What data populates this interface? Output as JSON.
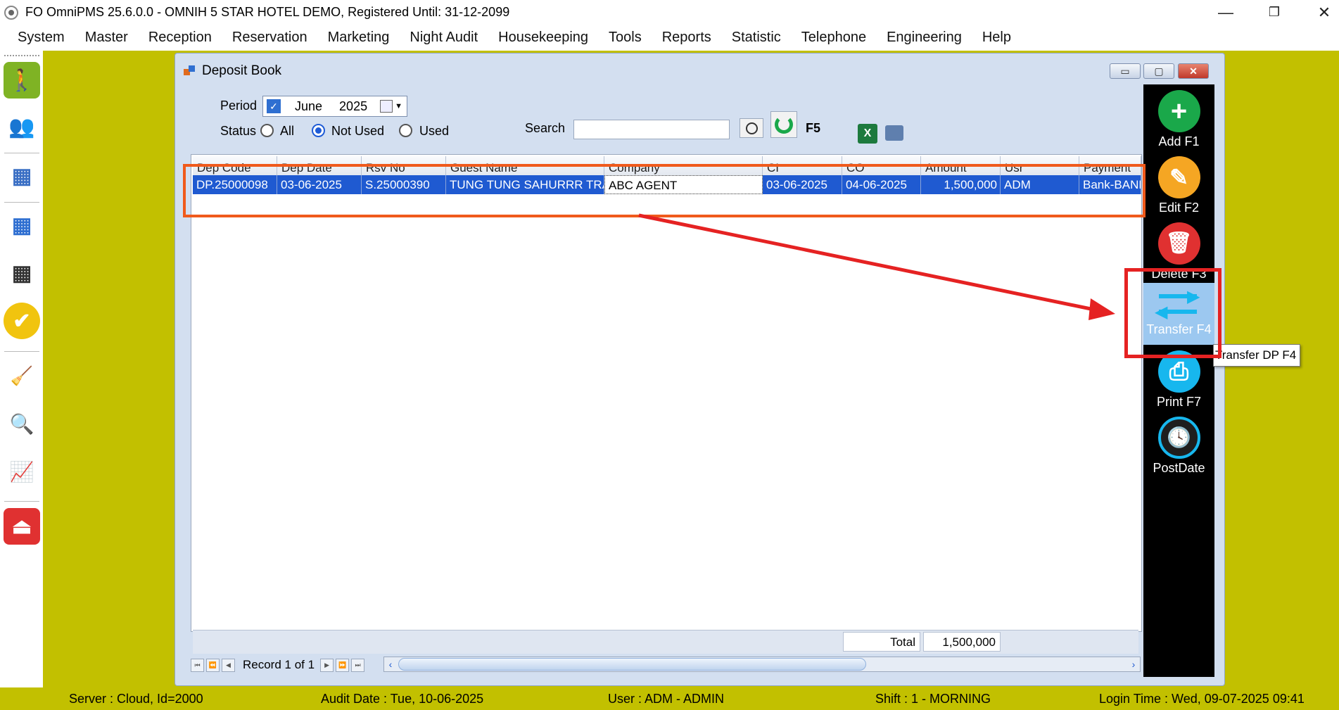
{
  "app": {
    "title": "FO OmniPMS 25.6.0.0 - OMNIH 5 STAR HOTEL DEMO, Registered Until: 31-12-2099",
    "controls": {
      "minimize": "—",
      "restore": "❐",
      "close": "✕"
    }
  },
  "menu": [
    "System",
    "Master",
    "Reception",
    "Reservation",
    "Marketing",
    "Night Audit",
    "Housekeeping",
    "Tools",
    "Reports",
    "Statistic",
    "Telephone",
    "Engineering",
    "Help"
  ],
  "sidebar": {
    "icons": [
      {
        "name": "walk-in-icon",
        "color": "#7fb324",
        "glyph": "🚶"
      },
      {
        "name": "guests-icon",
        "color": "#ffffff",
        "glyph": "👥"
      },
      {
        "name": "room-plan-icon",
        "color": "#ffffff",
        "glyph": "▦"
      },
      {
        "name": "calendar-grid-icon",
        "color": "#ffffff",
        "glyph": "▦"
      },
      {
        "name": "calendar-2023-icon",
        "color": "#ffffff",
        "glyph": "▦"
      },
      {
        "name": "availability-icon",
        "color": "#f1c40f",
        "glyph": "✔"
      },
      {
        "name": "housekeeping-icon",
        "color": "#ffffff",
        "glyph": "🧹"
      },
      {
        "name": "analysis-icon",
        "color": "#ffffff",
        "glyph": "🔍"
      },
      {
        "name": "statistics-icon",
        "color": "#ffffff",
        "glyph": "📈"
      },
      {
        "name": "exit-icon",
        "color": "#e03131",
        "glyph": "⏏"
      }
    ]
  },
  "window": {
    "title": "Deposit Book",
    "controls": {
      "minimize": "▭",
      "maximize": "▢",
      "close": "✕"
    }
  },
  "filter": {
    "period_label": "Period",
    "period_month": "June",
    "period_year": "2025",
    "status_label": "Status",
    "status_options": [
      "All",
      "Not Used",
      "Used"
    ],
    "status_selected": "Not Used",
    "search_label": "Search",
    "search_value": "",
    "refresh_shortcut": "F5",
    "excel_glyph": "X"
  },
  "grid": {
    "columns": [
      "Dep Code",
      "Dep Date",
      "Rsv No",
      "Guest Name",
      "Company",
      "CI",
      "CO",
      "Amount",
      "Usr",
      "Payment"
    ],
    "rows": [
      [
        "DP.25000098",
        "03-06-2025",
        "S.25000390",
        "TUNG TUNG SAHURRR TRA…",
        "ABC AGENT",
        "03-06-2025",
        "04-06-2025",
        "1,500,000",
        "ADM",
        "Bank-BANK"
      ]
    ],
    "total_label": "Total",
    "total_value": "1,500,000",
    "record_text": "Record 1 of 1"
  },
  "tools": [
    {
      "label": "Add F1",
      "color": "#1aa84a",
      "glyph": "+"
    },
    {
      "label": "Edit F2",
      "color": "#f5a623",
      "glyph": "✎"
    },
    {
      "label": "Delete F3",
      "color": "#e03131",
      "glyph": "🗑"
    },
    {
      "label": "Transfer F4",
      "color": "#17b7ee",
      "glyph": "⇄"
    },
    {
      "label": "Print F7",
      "color": "#17b7ee",
      "glyph": "⎙"
    },
    {
      "label": "PostDate",
      "color": "#1e1e1e",
      "glyph": "🕓"
    }
  ],
  "tooltip": "Transfer DP F4",
  "status": {
    "server": "Server : Cloud, Id=2000",
    "audit_date": "Audit Date : Tue, 10-06-2025",
    "user": "User : ADM - ADMIN",
    "shift": "Shift : 1 - MORNING",
    "login_time": "Login Time : Wed, 09-07-2025 09:41"
  },
  "colors": {
    "accent": "#1f5ad1",
    "background": "#c2c000",
    "highlight_box": "#f05a1c",
    "annotation_red": "#e52222"
  }
}
